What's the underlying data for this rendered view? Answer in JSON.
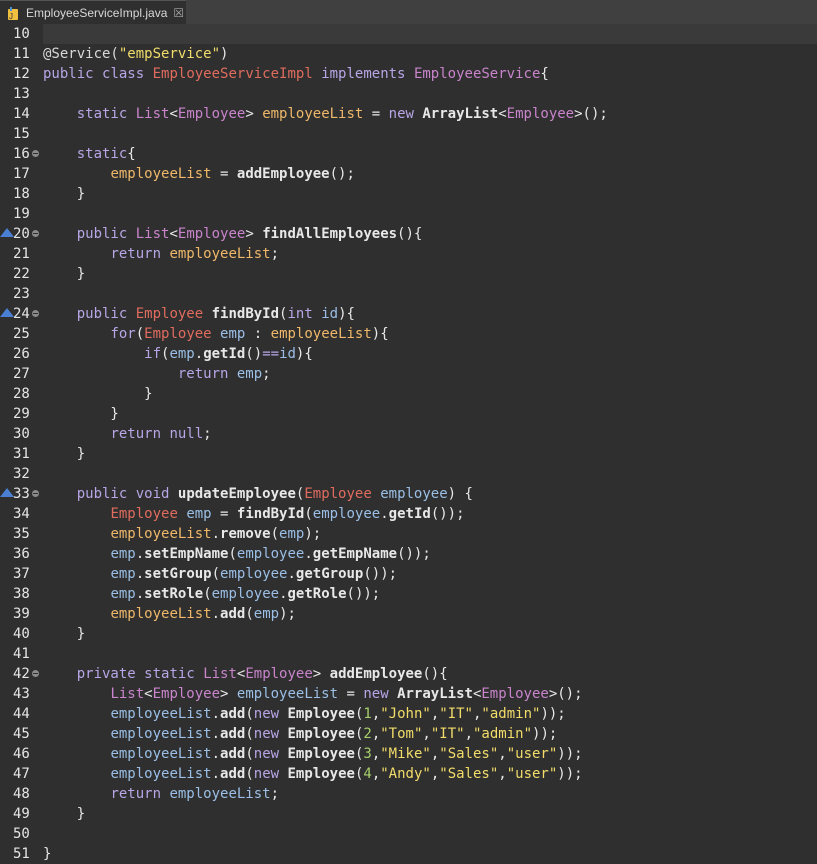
{
  "tab": {
    "title": "EmployeeServiceImpl.java",
    "close_glyph": "☒"
  },
  "editor": {
    "first_line_number": 10,
    "line_numbers": [
      "10",
      "11",
      "12",
      "13",
      "14",
      "15",
      "16",
      "17",
      "18",
      "19",
      "20",
      "21",
      "22",
      "23",
      "24",
      "25",
      "26",
      "27",
      "28",
      "29",
      "30",
      "31",
      "32",
      "33",
      "34",
      "35",
      "36",
      "37",
      "38",
      "39",
      "40",
      "41",
      "42",
      "43",
      "44",
      "45",
      "46",
      "47",
      "48",
      "49",
      "50",
      "51"
    ],
    "fold_markers": [
      "16",
      "20",
      "24",
      "33",
      "42"
    ],
    "override_markers": [
      "20",
      "24",
      "33"
    ],
    "colors": {
      "keyword": "#b8a6e6",
      "type": "#c984cc",
      "class": "#e06c5e",
      "field": "#efb86a",
      "variable": "#9bbfe6",
      "string": "#f2dc6a",
      "number": "#a7cf6b",
      "background": "#2f2f2f"
    },
    "lines": [
      [],
      [
        [
          "ann",
          "@Service("
        ],
        [
          "str",
          "\"empService\""
        ],
        [
          "plain",
          ")"
        ]
      ],
      [
        [
          "kw",
          "public"
        ],
        [
          "plain",
          " "
        ],
        [
          "kw",
          "class"
        ],
        [
          "plain",
          " "
        ],
        [
          "cls",
          "EmployeeServiceImpl"
        ],
        [
          "plain",
          " "
        ],
        [
          "kw",
          "implements"
        ],
        [
          "plain",
          " "
        ],
        [
          "type",
          "EmployeeService"
        ],
        [
          "plain",
          "{"
        ]
      ],
      [],
      [
        [
          "plain",
          "    "
        ],
        [
          "kw",
          "static"
        ],
        [
          "plain",
          " "
        ],
        [
          "type",
          "List"
        ],
        [
          "plain",
          "<"
        ],
        [
          "type",
          "Employee"
        ],
        [
          "plain",
          "> "
        ],
        [
          "field",
          "employeeList"
        ],
        [
          "plain",
          " = "
        ],
        [
          "kw",
          "new"
        ],
        [
          "plain",
          " "
        ],
        [
          "method",
          "ArrayList"
        ],
        [
          "plain",
          "<"
        ],
        [
          "type",
          "Employee"
        ],
        [
          "plain",
          ">();"
        ]
      ],
      [],
      [
        [
          "plain",
          "    "
        ],
        [
          "kw",
          "static"
        ],
        [
          "plain",
          "{"
        ]
      ],
      [
        [
          "plain",
          "        "
        ],
        [
          "field",
          "employeeList"
        ],
        [
          "plain",
          " = "
        ],
        [
          "method",
          "addEmployee"
        ],
        [
          "plain",
          "();"
        ]
      ],
      [
        [
          "plain",
          "    }"
        ]
      ],
      [],
      [
        [
          "plain",
          "    "
        ],
        [
          "kw",
          "public"
        ],
        [
          "plain",
          " "
        ],
        [
          "type",
          "List"
        ],
        [
          "plain",
          "<"
        ],
        [
          "type",
          "Employee"
        ],
        [
          "plain",
          "> "
        ],
        [
          "method",
          "findAllEmployees"
        ],
        [
          "plain",
          "(){"
        ]
      ],
      [
        [
          "plain",
          "        "
        ],
        [
          "kw",
          "return"
        ],
        [
          "plain",
          " "
        ],
        [
          "field",
          "employeeList"
        ],
        [
          "plain",
          ";"
        ]
      ],
      [
        [
          "plain",
          "    }"
        ]
      ],
      [],
      [
        [
          "plain",
          "    "
        ],
        [
          "kw",
          "public"
        ],
        [
          "plain",
          " "
        ],
        [
          "cls",
          "Employee"
        ],
        [
          "plain",
          " "
        ],
        [
          "method",
          "findById"
        ],
        [
          "plain",
          "("
        ],
        [
          "kw",
          "int"
        ],
        [
          "plain",
          " "
        ],
        [
          "var",
          "id"
        ],
        [
          "plain",
          "){"
        ]
      ],
      [
        [
          "plain",
          "        "
        ],
        [
          "kw",
          "for"
        ],
        [
          "plain",
          "("
        ],
        [
          "cls",
          "Employee"
        ],
        [
          "plain",
          " "
        ],
        [
          "var",
          "emp"
        ],
        [
          "plain",
          " : "
        ],
        [
          "field",
          "employeeList"
        ],
        [
          "plain",
          "){"
        ]
      ],
      [
        [
          "plain",
          "            "
        ],
        [
          "kw",
          "if"
        ],
        [
          "plain",
          "("
        ],
        [
          "var",
          "emp"
        ],
        [
          "plain",
          "."
        ],
        [
          "method",
          "getId"
        ],
        [
          "plain",
          "()"
        ],
        [
          "op",
          "=="
        ],
        [
          "var",
          "id"
        ],
        [
          "plain",
          "){"
        ]
      ],
      [
        [
          "plain",
          "                "
        ],
        [
          "kw",
          "return"
        ],
        [
          "plain",
          " "
        ],
        [
          "var",
          "emp"
        ],
        [
          "plain",
          ";"
        ]
      ],
      [
        [
          "plain",
          "            }"
        ]
      ],
      [
        [
          "plain",
          "        }"
        ]
      ],
      [
        [
          "plain",
          "        "
        ],
        [
          "kw",
          "return"
        ],
        [
          "plain",
          " "
        ],
        [
          "kw",
          "null"
        ],
        [
          "plain",
          ";"
        ]
      ],
      [
        [
          "plain",
          "    }"
        ]
      ],
      [],
      [
        [
          "plain",
          "    "
        ],
        [
          "kw",
          "public"
        ],
        [
          "plain",
          " "
        ],
        [
          "kw",
          "void"
        ],
        [
          "plain",
          " "
        ],
        [
          "method",
          "updateEmployee"
        ],
        [
          "plain",
          "("
        ],
        [
          "cls",
          "Employee"
        ],
        [
          "plain",
          " "
        ],
        [
          "var",
          "employee"
        ],
        [
          "plain",
          ") {"
        ]
      ],
      [
        [
          "plain",
          "        "
        ],
        [
          "cls",
          "Employee"
        ],
        [
          "plain",
          " "
        ],
        [
          "var",
          "emp"
        ],
        [
          "plain",
          " = "
        ],
        [
          "method",
          "findById"
        ],
        [
          "plain",
          "("
        ],
        [
          "var",
          "employee"
        ],
        [
          "plain",
          "."
        ],
        [
          "method",
          "getId"
        ],
        [
          "plain",
          "());"
        ]
      ],
      [
        [
          "plain",
          "        "
        ],
        [
          "field",
          "employeeList"
        ],
        [
          "plain",
          "."
        ],
        [
          "method",
          "remove"
        ],
        [
          "plain",
          "("
        ],
        [
          "var",
          "emp"
        ],
        [
          "plain",
          ");"
        ]
      ],
      [
        [
          "plain",
          "        "
        ],
        [
          "var",
          "emp"
        ],
        [
          "plain",
          "."
        ],
        [
          "method",
          "setEmpName"
        ],
        [
          "plain",
          "("
        ],
        [
          "var",
          "employee"
        ],
        [
          "plain",
          "."
        ],
        [
          "method",
          "getEmpName"
        ],
        [
          "plain",
          "());"
        ]
      ],
      [
        [
          "plain",
          "        "
        ],
        [
          "var",
          "emp"
        ],
        [
          "plain",
          "."
        ],
        [
          "method",
          "setGroup"
        ],
        [
          "plain",
          "("
        ],
        [
          "var",
          "employee"
        ],
        [
          "plain",
          "."
        ],
        [
          "method",
          "getGroup"
        ],
        [
          "plain",
          "());"
        ]
      ],
      [
        [
          "plain",
          "        "
        ],
        [
          "var",
          "emp"
        ],
        [
          "plain",
          "."
        ],
        [
          "method",
          "setRole"
        ],
        [
          "plain",
          "("
        ],
        [
          "var",
          "employee"
        ],
        [
          "plain",
          "."
        ],
        [
          "method",
          "getRole"
        ],
        [
          "plain",
          "());"
        ]
      ],
      [
        [
          "plain",
          "        "
        ],
        [
          "field",
          "employeeList"
        ],
        [
          "plain",
          "."
        ],
        [
          "method",
          "add"
        ],
        [
          "plain",
          "("
        ],
        [
          "var",
          "emp"
        ],
        [
          "plain",
          ");"
        ]
      ],
      [
        [
          "plain",
          "    }"
        ]
      ],
      [],
      [
        [
          "plain",
          "    "
        ],
        [
          "kw",
          "private"
        ],
        [
          "plain",
          " "
        ],
        [
          "kw",
          "static"
        ],
        [
          "plain",
          " "
        ],
        [
          "type",
          "List"
        ],
        [
          "plain",
          "<"
        ],
        [
          "type",
          "Employee"
        ],
        [
          "plain",
          "> "
        ],
        [
          "method",
          "addEmployee"
        ],
        [
          "plain",
          "(){"
        ]
      ],
      [
        [
          "plain",
          "        "
        ],
        [
          "type",
          "List"
        ],
        [
          "plain",
          "<"
        ],
        [
          "type",
          "Employee"
        ],
        [
          "plain",
          "> "
        ],
        [
          "var",
          "employeeList"
        ],
        [
          "plain",
          " = "
        ],
        [
          "kw",
          "new"
        ],
        [
          "plain",
          " "
        ],
        [
          "method",
          "ArrayList"
        ],
        [
          "plain",
          "<"
        ],
        [
          "type",
          "Employee"
        ],
        [
          "plain",
          ">();"
        ]
      ],
      [
        [
          "plain",
          "        "
        ],
        [
          "var",
          "employeeList"
        ],
        [
          "plain",
          "."
        ],
        [
          "method",
          "add"
        ],
        [
          "plain",
          "("
        ],
        [
          "kw",
          "new"
        ],
        [
          "plain",
          " "
        ],
        [
          "method",
          "Employee"
        ],
        [
          "plain",
          "("
        ],
        [
          "num",
          "1"
        ],
        [
          "plain",
          ","
        ],
        [
          "str",
          "\"John\""
        ],
        [
          "plain",
          ","
        ],
        [
          "str",
          "\"IT\""
        ],
        [
          "plain",
          ","
        ],
        [
          "str",
          "\"admin\""
        ],
        [
          "plain",
          "));"
        ]
      ],
      [
        [
          "plain",
          "        "
        ],
        [
          "var",
          "employeeList"
        ],
        [
          "plain",
          "."
        ],
        [
          "method",
          "add"
        ],
        [
          "plain",
          "("
        ],
        [
          "kw",
          "new"
        ],
        [
          "plain",
          " "
        ],
        [
          "method",
          "Employee"
        ],
        [
          "plain",
          "("
        ],
        [
          "num",
          "2"
        ],
        [
          "plain",
          ","
        ],
        [
          "str",
          "\"Tom\""
        ],
        [
          "plain",
          ","
        ],
        [
          "str",
          "\"IT\""
        ],
        [
          "plain",
          ","
        ],
        [
          "str",
          "\"admin\""
        ],
        [
          "plain",
          "));"
        ]
      ],
      [
        [
          "plain",
          "        "
        ],
        [
          "var",
          "employeeList"
        ],
        [
          "plain",
          "."
        ],
        [
          "method",
          "add"
        ],
        [
          "plain",
          "("
        ],
        [
          "kw",
          "new"
        ],
        [
          "plain",
          " "
        ],
        [
          "method",
          "Employee"
        ],
        [
          "plain",
          "("
        ],
        [
          "num",
          "3"
        ],
        [
          "plain",
          ","
        ],
        [
          "str",
          "\"Mike\""
        ],
        [
          "plain",
          ","
        ],
        [
          "str",
          "\"Sales\""
        ],
        [
          "plain",
          ","
        ],
        [
          "str",
          "\"user\""
        ],
        [
          "plain",
          "));"
        ]
      ],
      [
        [
          "plain",
          "        "
        ],
        [
          "var",
          "employeeList"
        ],
        [
          "plain",
          "."
        ],
        [
          "method",
          "add"
        ],
        [
          "plain",
          "("
        ],
        [
          "kw",
          "new"
        ],
        [
          "plain",
          " "
        ],
        [
          "method",
          "Employee"
        ],
        [
          "plain",
          "("
        ],
        [
          "num",
          "4"
        ],
        [
          "plain",
          ","
        ],
        [
          "str",
          "\"Andy\""
        ],
        [
          "plain",
          ","
        ],
        [
          "str",
          "\"Sales\""
        ],
        [
          "plain",
          ","
        ],
        [
          "str",
          "\"user\""
        ],
        [
          "plain",
          "));"
        ]
      ],
      [
        [
          "plain",
          "        "
        ],
        [
          "kw",
          "return"
        ],
        [
          "plain",
          " "
        ],
        [
          "var",
          "employeeList"
        ],
        [
          "plain",
          ";"
        ]
      ],
      [
        [
          "plain",
          "    }"
        ]
      ],
      [],
      [
        [
          "plain",
          "}"
        ]
      ]
    ]
  }
}
